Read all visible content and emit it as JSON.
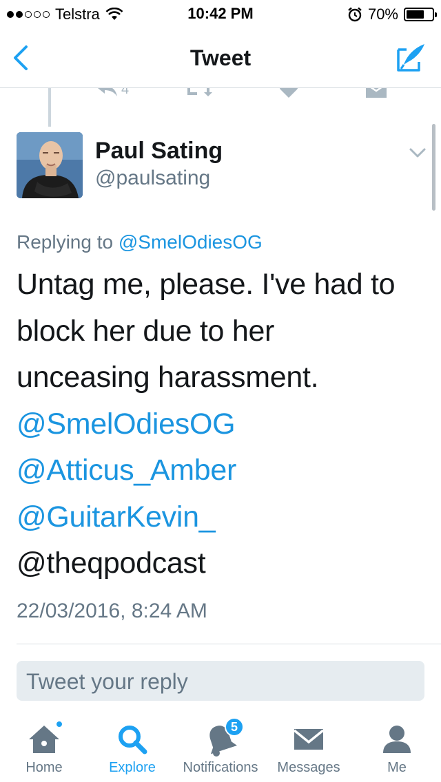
{
  "status_bar": {
    "carrier": "Telstra",
    "time": "10:42 PM",
    "battery_percent": "70%",
    "battery_level": 0.7,
    "signal_bars_filled": 2,
    "signal_bars_total": 5
  },
  "nav": {
    "title": "Tweet",
    "back_icon": "chevron-left-icon",
    "compose_icon": "compose-tweet-icon"
  },
  "previous_tweet": {
    "reply_count": "4"
  },
  "tweet": {
    "author_name": "Paul Sating",
    "author_handle": "@paulsating",
    "replying_prefix": "Replying to",
    "replying_to": "@SmelOdiesOG",
    "text_lines": [
      "Untag me, please. I've had to",
      "block her due to her",
      "unceasing harassment."
    ],
    "mentions": [
      "@SmelOdiesOG",
      "@Atticus_Amber",
      "@GuitarKevin_"
    ],
    "trailing_text": "@theqpodcast",
    "timestamp": "22/03/2016, 8:24 AM"
  },
  "reply_box": {
    "placeholder": "Tweet your reply"
  },
  "tab_bar": {
    "tabs": [
      {
        "label": "Home",
        "icon": "home-icon",
        "active": false,
        "has_dot": true
      },
      {
        "label": "Explore",
        "icon": "search-icon",
        "active": true
      },
      {
        "label": "Notifications",
        "icon": "bell-icon",
        "active": false,
        "badge": "5"
      },
      {
        "label": "Messages",
        "icon": "envelope-icon",
        "active": false
      },
      {
        "label": "Me",
        "icon": "person-icon",
        "active": false
      }
    ]
  },
  "colors": {
    "accent": "#1da1f2",
    "link": "#1b95e0",
    "secondary_text": "#657786",
    "primary_text": "#14171a",
    "icon_inactive": "#657786"
  }
}
